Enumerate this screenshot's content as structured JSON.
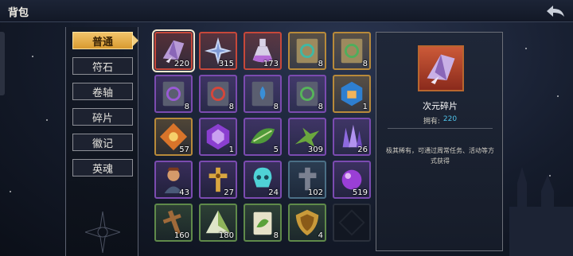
{
  "window": {
    "title": "背包"
  },
  "tabs": [
    {
      "label": "普通",
      "active": true
    },
    {
      "label": "符石",
      "active": false
    },
    {
      "label": "卷轴",
      "active": false
    },
    {
      "label": "碎片",
      "active": false
    },
    {
      "label": "徽记",
      "active": false
    },
    {
      "label": "英魂",
      "active": false
    }
  ],
  "inventory": {
    "rows": [
      [
        {
          "item": "crystal-shard",
          "count": "220",
          "rarity": "red",
          "selected": true
        },
        {
          "item": "star-fragment",
          "count": "315",
          "rarity": "red"
        },
        {
          "item": "potion-flask",
          "count": "173",
          "rarity": "red"
        },
        {
          "item": "scroll-teal-rune",
          "count": "8",
          "rarity": "gold"
        },
        {
          "item": "scroll-green-rune",
          "count": "8",
          "rarity": "gold"
        }
      ],
      [
        {
          "item": "scroll-purple-rune",
          "count": "8",
          "rarity": "purple"
        },
        {
          "item": "scroll-red-rune",
          "count": "8",
          "rarity": "purple"
        },
        {
          "item": "scroll-blue-drop",
          "count": "8",
          "rarity": "purple"
        },
        {
          "item": "scroll-green-sigil",
          "count": "8",
          "rarity": "purple"
        },
        {
          "item": "blue-rune-stone",
          "count": "1",
          "rarity": "gold"
        }
      ],
      [
        {
          "item": "orange-emblem",
          "count": "57",
          "rarity": "gold"
        },
        {
          "item": "purple-gem",
          "count": "1",
          "rarity": "purple"
        },
        {
          "item": "green-leaf-talisman",
          "count": "5",
          "rarity": "purple"
        },
        {
          "item": "green-dragon",
          "count": "309",
          "rarity": "purple"
        },
        {
          "item": "purple-crystals",
          "count": "26",
          "rarity": "purple"
        }
      ],
      [
        {
          "item": "warrior-portrait",
          "count": "43",
          "rarity": "purple"
        },
        {
          "item": "golden-cross",
          "count": "27",
          "rarity": "purple"
        },
        {
          "item": "cyan-skull",
          "count": "24",
          "rarity": "purple"
        },
        {
          "item": "stone-cross",
          "count": "102",
          "rarity": "blue"
        },
        {
          "item": "purple-orb",
          "count": "519",
          "rarity": "purple"
        }
      ],
      [
        {
          "item": "wooden-cross",
          "count": "160",
          "rarity": "green"
        },
        {
          "item": "rice-dumpling",
          "count": "180",
          "rarity": "green"
        },
        {
          "item": "herb-packet",
          "count": "8",
          "rarity": "green"
        },
        {
          "item": "golden-shield",
          "count": "4",
          "rarity": "green"
        },
        {
          "item": "empty",
          "count": "",
          "rarity": "empty"
        }
      ]
    ]
  },
  "detail": {
    "item_name": "次元碎片",
    "owned_label": "拥有:",
    "owned_value": "220",
    "description": "极其稀有，可通过周常任务、活动等方式获得"
  },
  "colors": {
    "active_tab": "#e2a844",
    "rarity_red": "#c7483a",
    "rarity_gold": "#b88a3a",
    "rarity_purple": "#7b4bb0",
    "rarity_blue": "#4b6f86",
    "rarity_green": "#5f8a4a",
    "owned_value": "#4fc3ea"
  }
}
